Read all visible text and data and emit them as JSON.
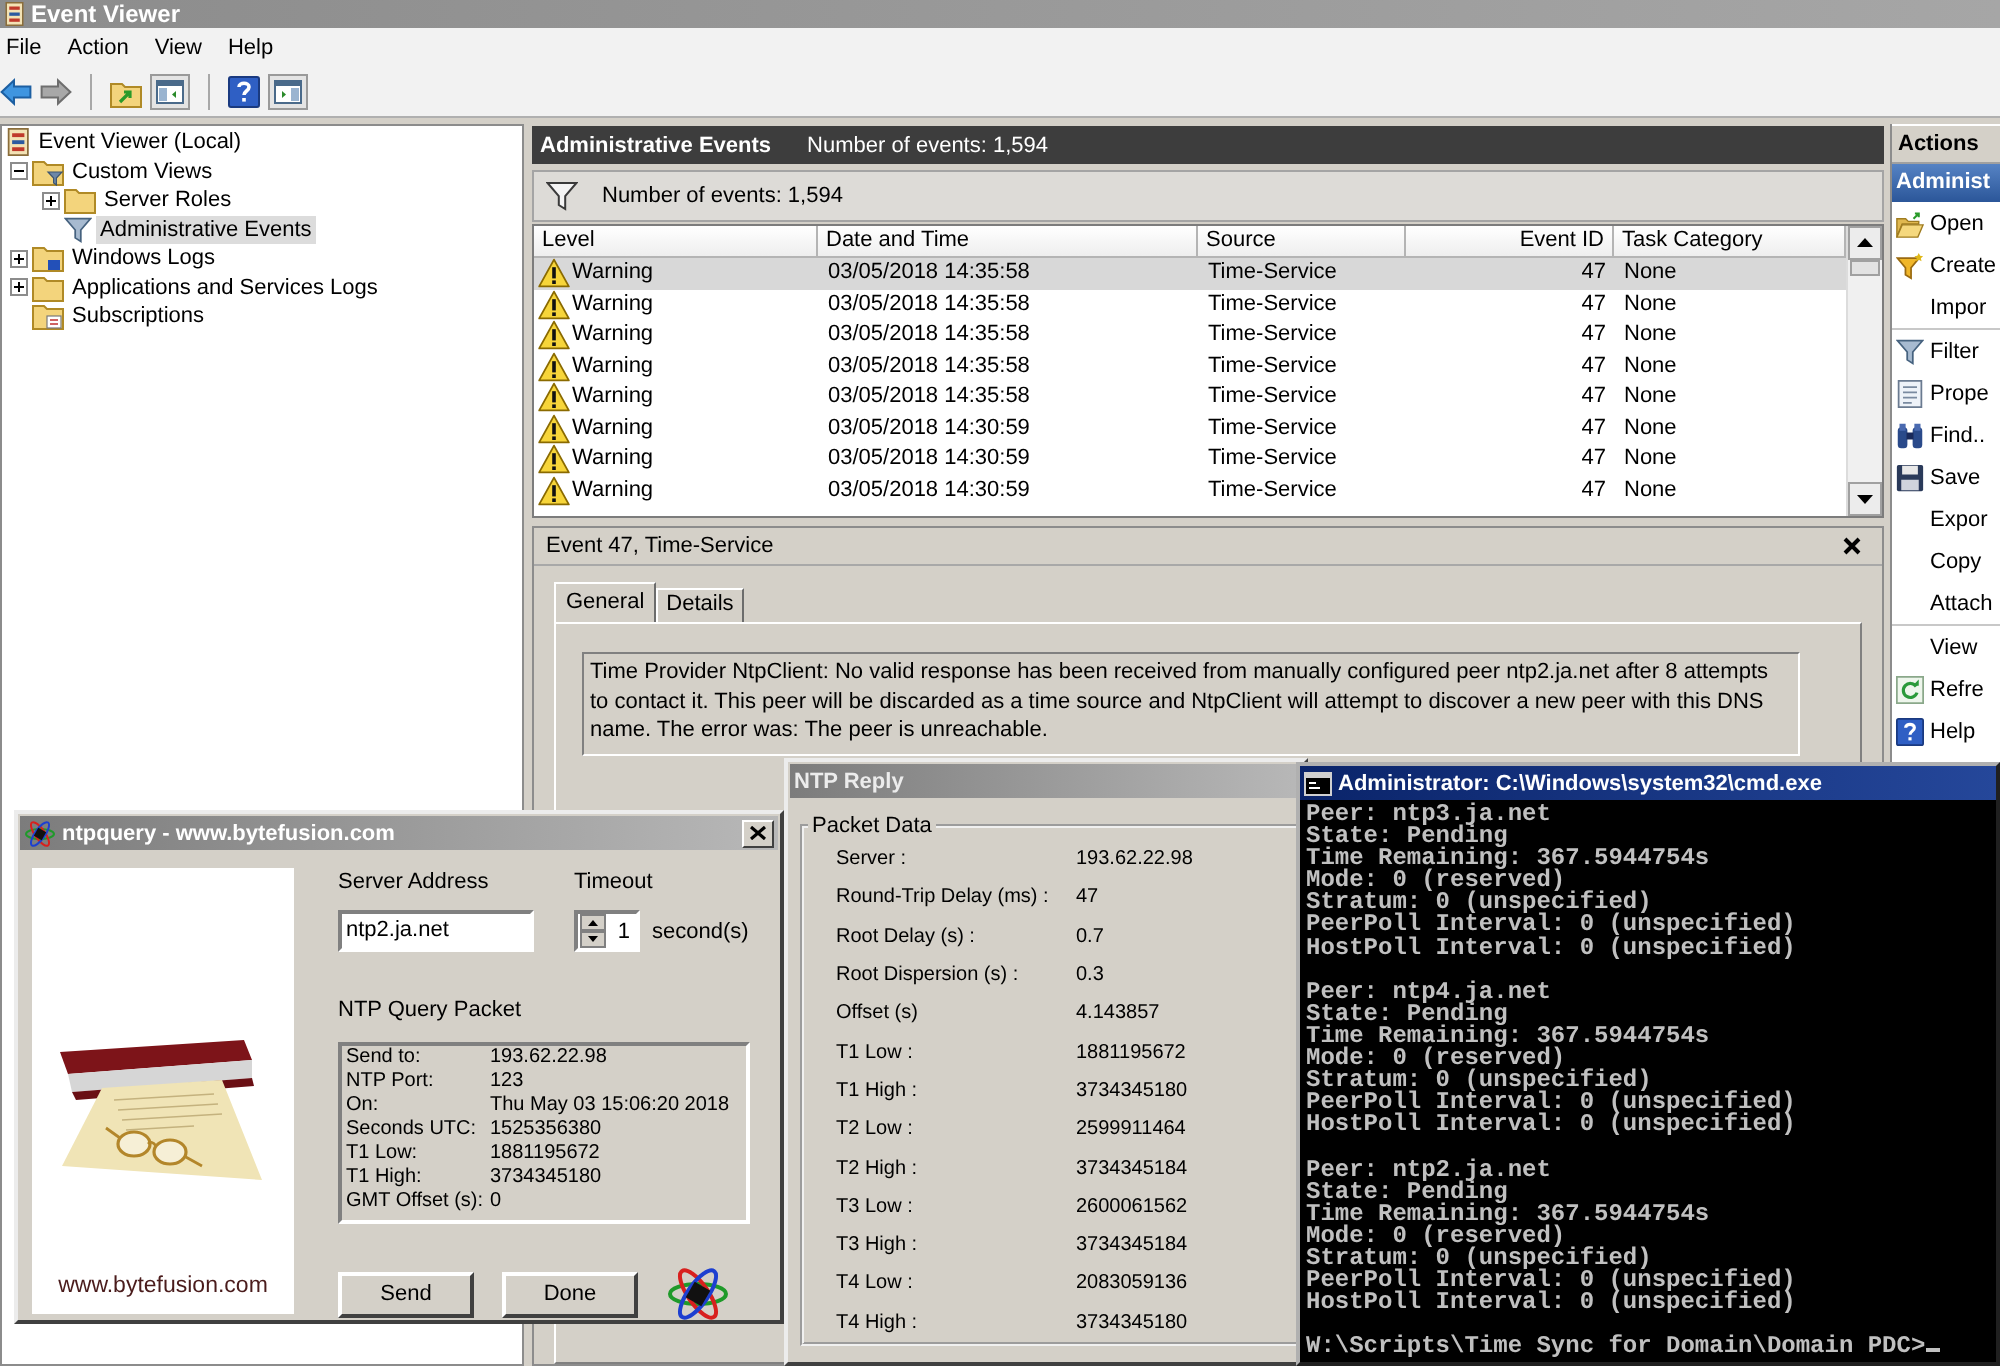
{
  "window": {
    "title": "Event Viewer"
  },
  "menu": [
    {
      "label": "File"
    },
    {
      "label": "Action"
    },
    {
      "label": "View"
    },
    {
      "label": "Help"
    }
  ],
  "tree": [
    {
      "label": "Event Viewer (Local)",
      "kind": "root",
      "selected": false,
      "children": [
        {
          "label": "Custom Views",
          "kind": "view-folder",
          "expanded": true,
          "selected": false,
          "children": [
            {
              "label": "Server Roles",
              "kind": "folder",
              "expanded": false,
              "selected": false
            },
            {
              "label": "Administrative Events",
              "kind": "view",
              "selected": true
            }
          ]
        },
        {
          "label": "Windows Logs",
          "kind": "log-folder",
          "expanded": false,
          "selected": false
        },
        {
          "label": "Applications and Services Logs",
          "kind": "folder",
          "expanded": false,
          "selected": false
        },
        {
          "label": "Subscriptions",
          "kind": "subscription-folder",
          "selected": false
        }
      ]
    }
  ],
  "view": {
    "title": "Administrative Events",
    "count": "Number of events: 1,594"
  },
  "filter_bar": {
    "count": "Number of events: 1,594"
  },
  "table": {
    "columns": [
      {
        "label": "Level"
      },
      {
        "label": "Date and Time"
      },
      {
        "label": "Source"
      },
      {
        "label": "Event ID"
      },
      {
        "label": "Task Category"
      }
    ],
    "rows": [
      {
        "kind": "warning",
        "level": "Warning",
        "date": "03/05/2018 14:35:58",
        "source": "Time-Service",
        "event_id": "47",
        "category": "None",
        "selected": true
      },
      {
        "kind": "warning",
        "level": "Warning",
        "date": "03/05/2018 14:35:58",
        "source": "Time-Service",
        "event_id": "47",
        "category": "None",
        "selected": false
      },
      {
        "kind": "warning",
        "level": "Warning",
        "date": "03/05/2018 14:35:58",
        "source": "Time-Service",
        "event_id": "47",
        "category": "None",
        "selected": false
      },
      {
        "kind": "warning",
        "level": "Warning",
        "date": "03/05/2018 14:35:58",
        "source": "Time-Service",
        "event_id": "47",
        "category": "None",
        "selected": false
      },
      {
        "kind": "warning",
        "level": "Warning",
        "date": "03/05/2018 14:35:58",
        "source": "Time-Service",
        "event_id": "47",
        "category": "None",
        "selected": false
      },
      {
        "kind": "warning",
        "level": "Warning",
        "date": "03/05/2018 14:30:59",
        "source": "Time-Service",
        "event_id": "47",
        "category": "None",
        "selected": false
      },
      {
        "kind": "warning",
        "level": "Warning",
        "date": "03/05/2018 14:30:59",
        "source": "Time-Service",
        "event_id": "47",
        "category": "None",
        "selected": false
      },
      {
        "kind": "warning",
        "level": "Warning",
        "date": "03/05/2018 14:30:59",
        "source": "Time-Service",
        "event_id": "47",
        "category": "None",
        "selected": false
      }
    ]
  },
  "event": {
    "title": "Event 47, Time-Service",
    "tabs": [
      {
        "label": "General",
        "selected": true
      },
      {
        "label": "Details",
        "selected": false
      }
    ],
    "message": "Time Provider NtpClient: No valid response has been received from manually configured peer ntp2.ja.net after 8 attempts to contact it. This peer will be discarded as a time source and NtpClient will attempt to discover a new peer with this DNS name. The error was: The peer is unreachable."
  },
  "actions": {
    "title": "Actions",
    "section": "Administ",
    "groups": [
      {
        "items": [
          {
            "label": "Open",
            "kind": "open"
          },
          {
            "label": "Create",
            "kind": "create"
          },
          {
            "label": "Impor",
            "kind": "plain"
          }
        ]
      },
      {
        "items": [
          {
            "label": "Filter",
            "kind": "filter"
          },
          {
            "label": "Prope",
            "kind": "properties"
          },
          {
            "label": "Find..",
            "kind": "find"
          },
          {
            "label": "Save",
            "kind": "save"
          },
          {
            "label": "Expor",
            "kind": "plain"
          },
          {
            "label": "Copy",
            "kind": "plain"
          },
          {
            "label": "Attach",
            "kind": "plain"
          }
        ]
      },
      {
        "items": [
          {
            "label": "View",
            "kind": "plain"
          },
          {
            "label": "Refre",
            "kind": "refresh"
          },
          {
            "label": "Help",
            "kind": "help"
          }
        ]
      }
    ]
  },
  "ntpquery": {
    "title": "ntpquery - www.bytefusion.com",
    "site": "www.bytefusion.com",
    "server_label": "Server Address",
    "server": "ntp2.ja.net",
    "timeout_label": "Timeout",
    "timeout": "1",
    "unit": "second(s)",
    "packet_label": "NTP Query Packet",
    "packet": [
      {
        "label": "Send to:",
        "value": "193.62.22.98"
      },
      {
        "label": "NTP Port:",
        "value": "123"
      },
      {
        "label": "On:",
        "value": "Thu May 03 15:06:20 2018"
      },
      {
        "label": "Seconds UTC:",
        "value": "1525356380"
      },
      {
        "label": "T1 Low:",
        "value": "1881195672"
      },
      {
        "label": "T1 High:",
        "value": "3734345180"
      },
      {
        "label": "GMT Offset (s):",
        "value": "0"
      }
    ],
    "buttons": [
      {
        "label": "Send"
      },
      {
        "label": "Done"
      }
    ]
  },
  "ntp_reply": {
    "title": "NTP Reply",
    "group": "Packet Data",
    "rows": [
      {
        "label": "Server :",
        "value": "193.62.22.98"
      },
      {
        "label": "Round-Trip Delay (ms) :",
        "value": "47"
      },
      {
        "label": "Root Delay (s) :",
        "value": "0.7"
      },
      {
        "label": "Root Dispersion (s) :",
        "value": "0.3"
      },
      {
        "label": "Offset (s)",
        "value": "4.143857"
      },
      {
        "label": "T1 Low :",
        "value": "1881195672"
      },
      {
        "label": "T1 High :",
        "value": "3734345180"
      },
      {
        "label": "T2 Low :",
        "value": "2599911464"
      },
      {
        "label": "T2 High :",
        "value": "3734345184"
      },
      {
        "label": "T3 Low :",
        "value": "2600061562"
      },
      {
        "label": "T3 High :",
        "value": "3734345184"
      },
      {
        "label": "T4 Low :",
        "value": "2083059136"
      },
      {
        "label": "T4 High :",
        "value": "3734345180"
      }
    ]
  },
  "console": {
    "title": "Administrator: C:\\Windows\\system32\\cmd.exe",
    "blocks": [
      {
        "lines": [
          "Peer: ntp3.ja.net",
          "State: Pending",
          "Time Remaining: 367.5944754s",
          "Mode: 0 (reserved)",
          "Stratum: 0 (unspecified)",
          "PeerPoll Interval: 0 (unspecified)",
          "HostPoll Interval: 0 (unspecified)"
        ]
      },
      {
        "lines": [
          "Peer: ntp4.ja.net",
          "State: Pending",
          "Time Remaining: 367.5944754s",
          "Mode: 0 (reserved)",
          "Stratum: 0 (unspecified)",
          "PeerPoll Interval: 0 (unspecified)",
          "HostPoll Interval: 0 (unspecified)"
        ]
      },
      {
        "lines": [
          "Peer: ntp2.ja.net",
          "State: Pending",
          "Time Remaining: 367.5944754s",
          "Mode: 0 (reserved)",
          "Stratum: 0 (unspecified)",
          "PeerPoll Interval: 0 (unspecified)",
          "HostPoll Interval: 0 (unspecified)"
        ]
      }
    ],
    "prompt": "W:\\Scripts\\Time Sync for Domain\\Domain PDC>"
  }
}
